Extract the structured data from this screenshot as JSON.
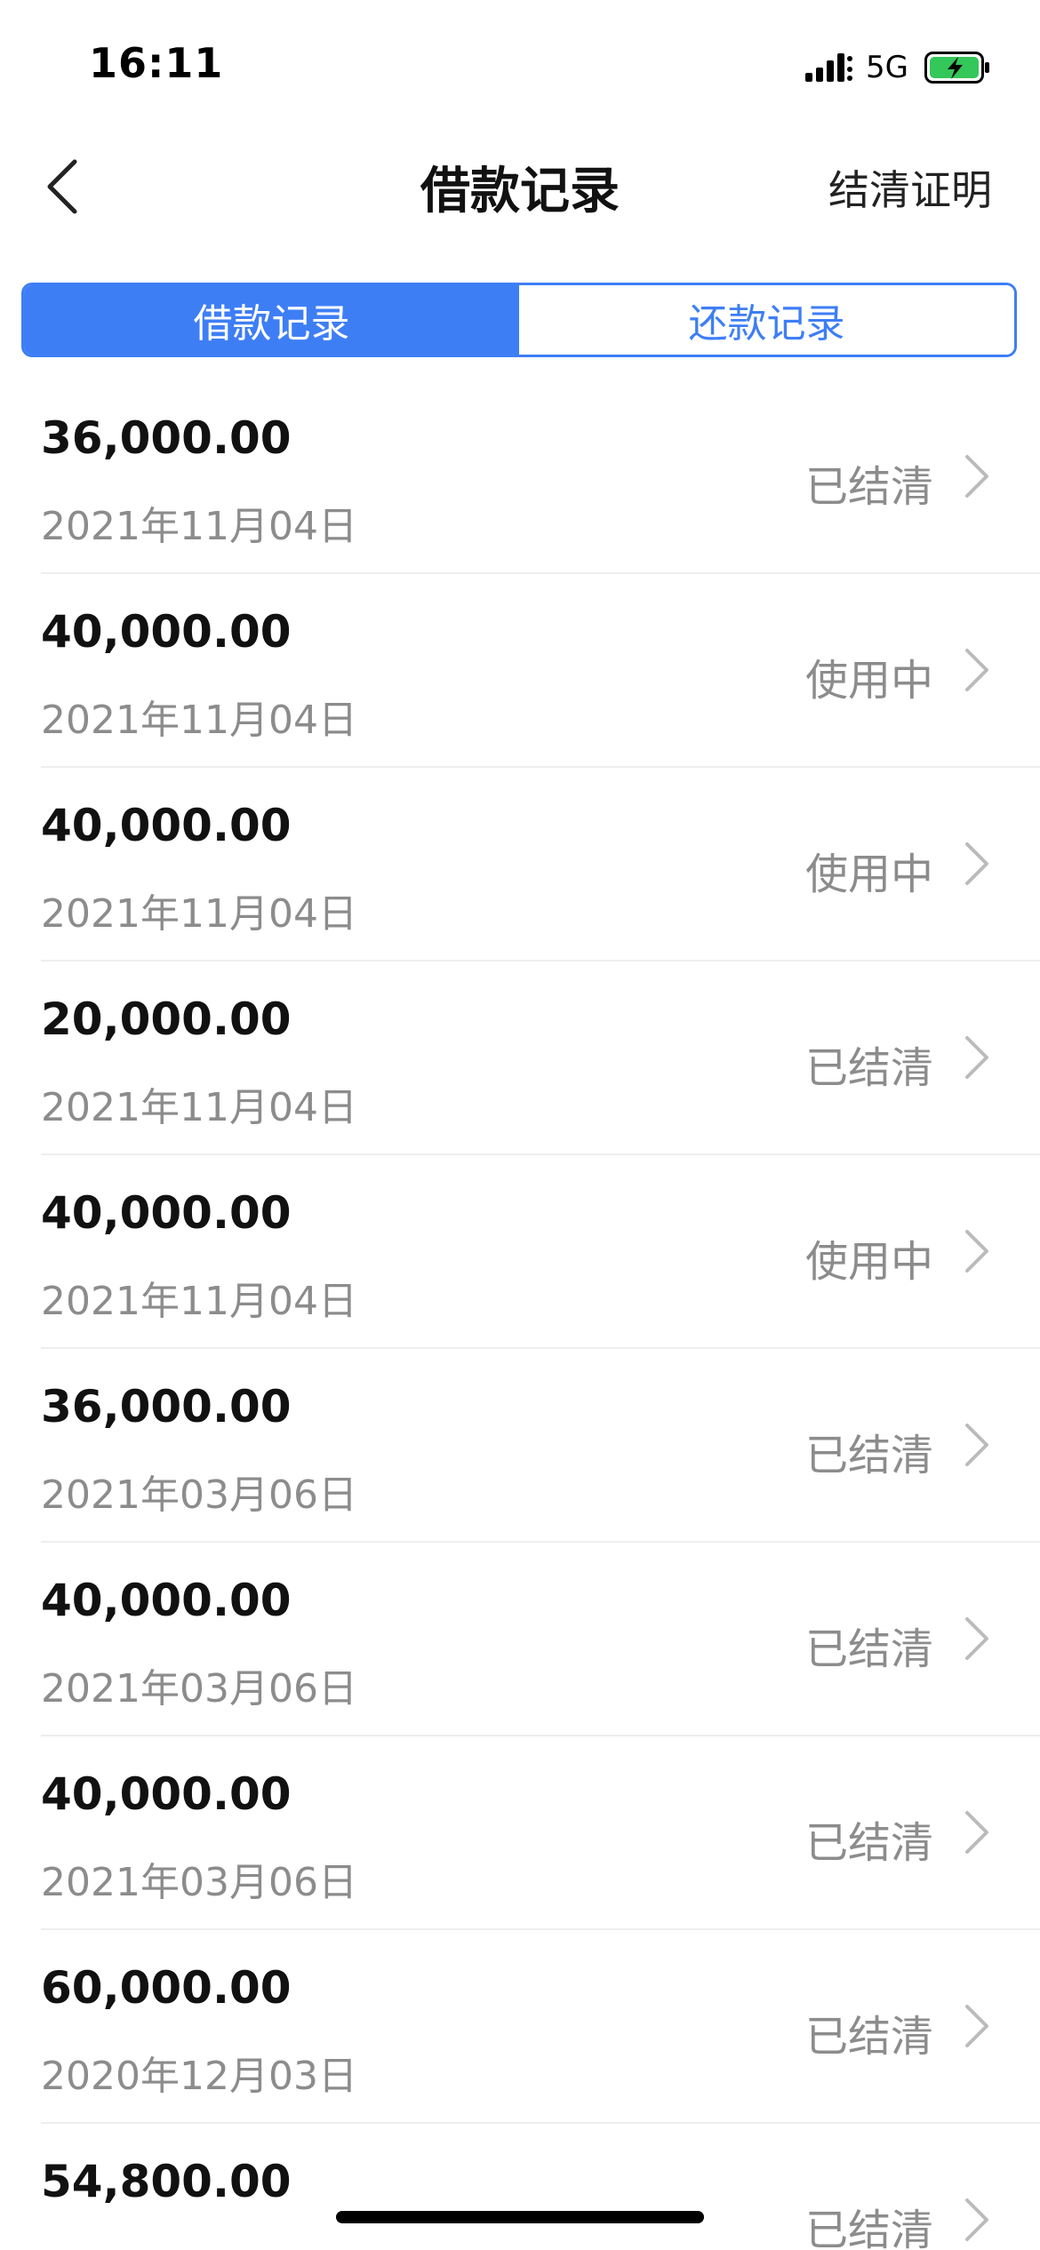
{
  "status_bar": {
    "time": "16:11",
    "network": "5G",
    "icons": [
      "signal-icon",
      "battery-charging-icon"
    ]
  },
  "nav": {
    "title": "借款记录",
    "action": "结清证明",
    "back_icon": "chevron-left-icon"
  },
  "tabs": [
    {
      "label": "借款记录",
      "active": true
    },
    {
      "label": "还款记录",
      "active": false
    }
  ],
  "records": [
    {
      "amount": "36,000.00",
      "date": "2021年11月04日",
      "status": "已结清"
    },
    {
      "amount": "40,000.00",
      "date": "2021年11月04日",
      "status": "使用中"
    },
    {
      "amount": "40,000.00",
      "date": "2021年11月04日",
      "status": "使用中"
    },
    {
      "amount": "20,000.00",
      "date": "2021年11月04日",
      "status": "已结清"
    },
    {
      "amount": "40,000.00",
      "date": "2021年11月04日",
      "status": "使用中"
    },
    {
      "amount": "36,000.00",
      "date": "2021年03月06日",
      "status": "已结清"
    },
    {
      "amount": "40,000.00",
      "date": "2021年03月06日",
      "status": "已结清"
    },
    {
      "amount": "40,000.00",
      "date": "2021年03月06日",
      "status": "已结清"
    },
    {
      "amount": "60,000.00",
      "date": "2020年12月03日",
      "status": "已结清"
    },
    {
      "amount": "54,800.00",
      "date": "",
      "status": "已结清"
    }
  ],
  "colors": {
    "accent": "#3e7ef5",
    "secondary_text": "#8c8c8c",
    "primary_text": "#111111",
    "battery_fill": "#34c759"
  }
}
